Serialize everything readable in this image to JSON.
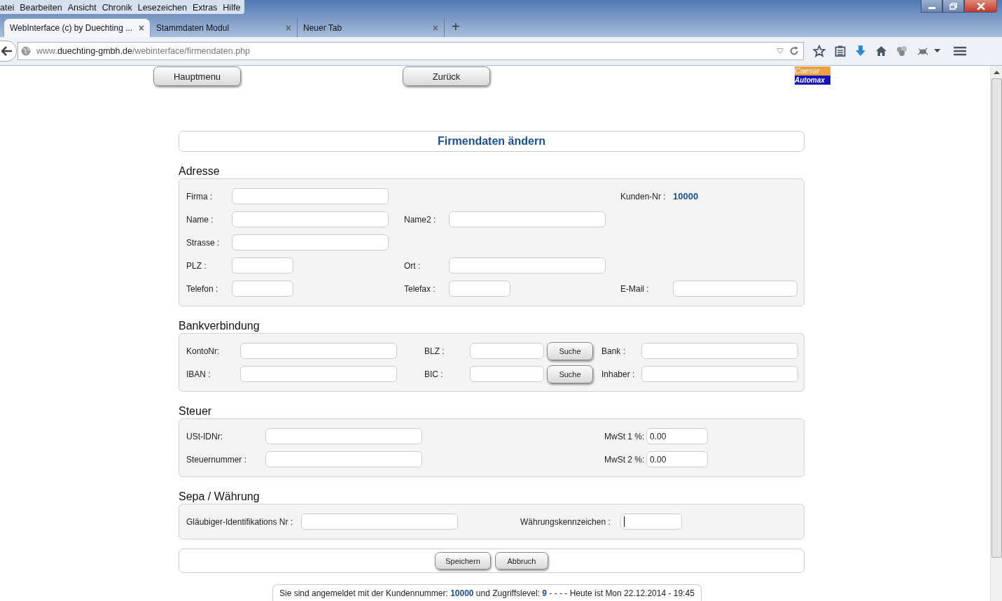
{
  "menu_bar": [
    "atei",
    "Bearbeiten",
    "Ansicht",
    "Chronik",
    "Lesezeichen",
    "Extras",
    "Hilfe"
  ],
  "tabs": [
    {
      "label": "WebInterface (c) by Duechting ...",
      "close": "×",
      "selected": true
    },
    {
      "label": "Stammdaten Modul",
      "close": "×",
      "selected": false
    },
    {
      "label": "Neuer Tab",
      "close": "×",
      "selected": false
    }
  ],
  "new_tab": "+",
  "address_bar": {
    "url": "www.**duechting-gmbh.de**/webinterface/firmendaten.php"
  },
  "top_buttons": [
    "Hauptmenu",
    "Zurück"
  ],
  "logo": {
    "top": "Caesar",
    "bottom": "Automax"
  },
  "title": "Firmendaten ändern",
  "sections": [
    {
      "heading": "Adresse",
      "rows": [
        [
          {
            "kind": "field",
            "label": "Firma :"
          },
          null,
          {
            "kind": "info",
            "label": "Kunden-Nr :",
            "value": "10000"
          }
        ],
        [
          {
            "kind": "field",
            "label": "Name :"
          },
          {
            "kind": "field",
            "label": "Name2 :"
          },
          null
        ],
        [
          {
            "kind": "field",
            "label": "Strasse :"
          },
          null,
          null
        ],
        [
          {
            "kind": "short-field",
            "label": "PLZ :"
          },
          {
            "kind": "field",
            "label": "Ort :"
          },
          null
        ],
        [
          {
            "kind": "short-field",
            "label": "Telefon :"
          },
          {
            "kind": "short-field",
            "label": "Telefax :"
          },
          {
            "kind": "field",
            "label": "E-Mail :"
          }
        ]
      ]
    },
    {
      "heading": "Bankverbindung",
      "rows": [
        [
          {
            "kind": "field",
            "label": "KontoNr:"
          },
          {
            "kind": "search",
            "label": "BLZ :",
            "button": "Suche"
          },
          {
            "kind": "field",
            "label": "Bank :"
          }
        ],
        [
          {
            "kind": "field",
            "label": "IBAN :"
          },
          {
            "kind": "search",
            "label": "BIC :",
            "button": "Suche"
          },
          {
            "kind": "field",
            "label": "Inhaber :"
          }
        ]
      ]
    },
    {
      "heading": "Steuer",
      "rows": [
        [
          {
            "kind": "field",
            "label": "USt-IDNr:"
          },
          null,
          {
            "kind": "short-field",
            "label": "MwSt 1 %:",
            "value": "0.00"
          }
        ],
        [
          {
            "kind": "field",
            "label": "Steuernummer :"
          },
          null,
          {
            "kind": "short-field",
            "label": "MwSt 2 %:",
            "value": "0.00"
          }
        ]
      ]
    },
    {
      "heading": "Sepa / Währung",
      "rows": [
        [
          {
            "kind": "field",
            "label": "Gläubiger-Identifikations Nr :"
          },
          {
            "kind": "short-field",
            "label": "Währungskennzeichen :",
            "focused": true
          }
        ]
      ]
    }
  ],
  "actions": [
    "Speichern",
    "Abbruch"
  ],
  "status": "Sie sind angemeldet mit der Kundennummer: **10000** und Zugriffslevel: **9** - - - - Heute ist Mon 22.12.2014 - 19:45"
}
